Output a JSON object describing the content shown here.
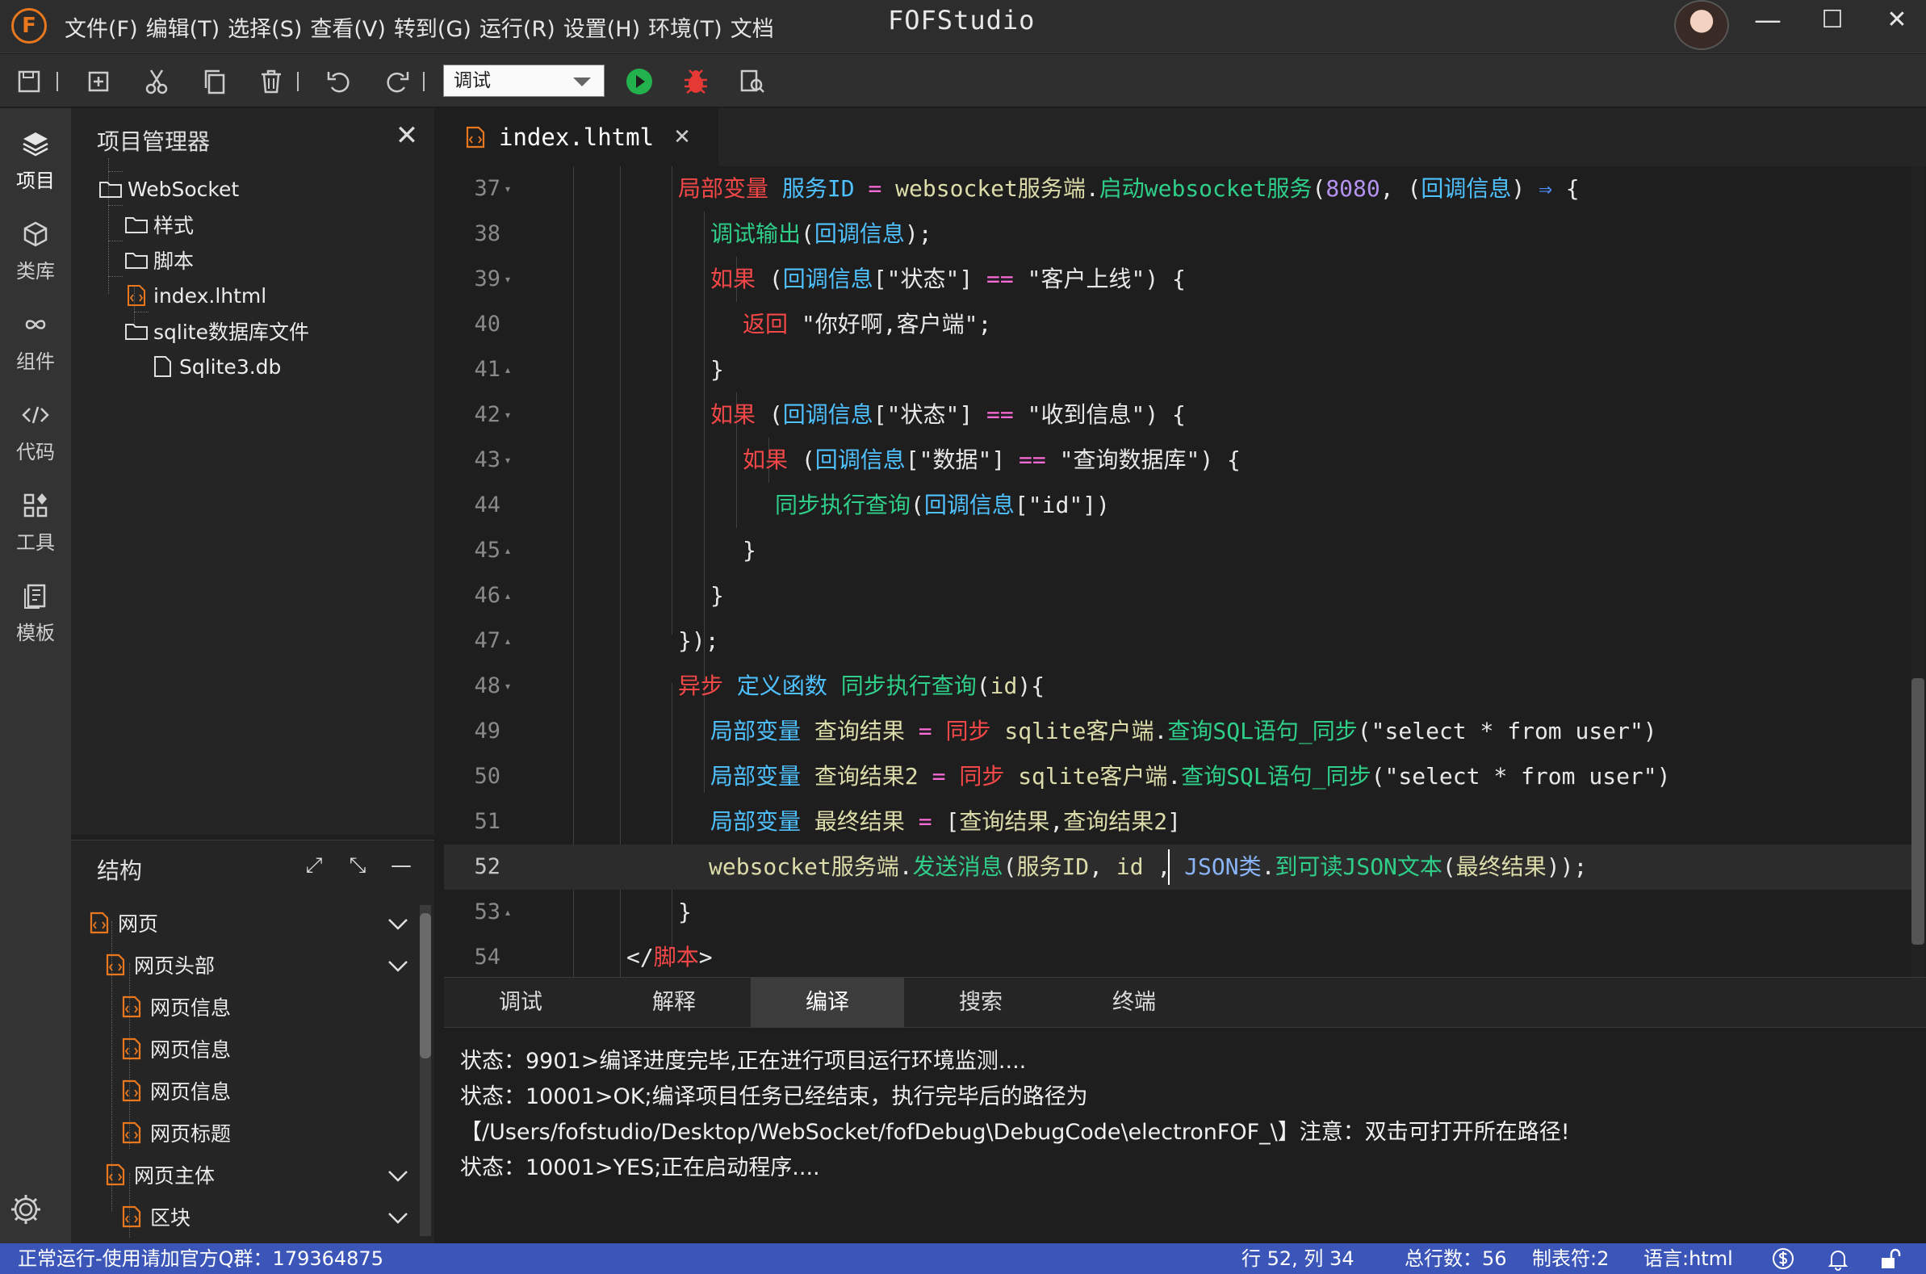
{
  "titlebar": {
    "logo": "F",
    "title": "FOFStudio",
    "menu": [
      "文件(F)",
      "编辑(T)",
      "选择(S)",
      "查看(V)",
      "转到(G)",
      "运行(R)",
      "设置(H)",
      "环境(T)",
      "文档"
    ],
    "window_buttons": {
      "minimize": "—",
      "maximize": "☐",
      "close": "✕"
    }
  },
  "toolbar": {
    "mode_value": "调试",
    "icons": [
      "save-icon",
      "new-file-icon",
      "cut-icon",
      "copy-icon",
      "delete-icon",
      "undo-icon",
      "redo-icon",
      "run-icon",
      "debug-icon",
      "find-icon"
    ]
  },
  "activitybar": {
    "items": [
      {
        "label": "项目",
        "icon": "layers-icon"
      },
      {
        "label": "类库",
        "icon": "cube-icon"
      },
      {
        "label": "组件",
        "icon": "infinity-icon"
      },
      {
        "label": "代码",
        "icon": "code-icon"
      },
      {
        "label": "工具",
        "icon": "tools-icon"
      },
      {
        "label": "模板",
        "icon": "template-icon"
      }
    ]
  },
  "project": {
    "title": "项目管理器",
    "close": "✕",
    "tree": [
      {
        "label": "WebSocket",
        "type": "folder"
      },
      {
        "label": "样式",
        "type": "folder"
      },
      {
        "label": "脚本",
        "type": "folder"
      },
      {
        "label": "index.lhtml",
        "type": "html"
      },
      {
        "label": "sqlite数据库文件",
        "type": "folder"
      },
      {
        "label": "Sqlite3.db",
        "type": "file"
      }
    ]
  },
  "structure": {
    "title": "结构",
    "expand": "⤢",
    "collapse": "⤡",
    "minimize": "—",
    "items": [
      {
        "label": "网页"
      },
      {
        "label": "网页头部"
      },
      {
        "label": "网页信息"
      },
      {
        "label": "网页信息"
      },
      {
        "label": "网页信息"
      },
      {
        "label": "网页标题"
      },
      {
        "label": "网页主体"
      },
      {
        "label": "区块"
      }
    ]
  },
  "editor": {
    "tab_label": "index.lhtml",
    "tab_close": "✕",
    "line_numbers": [
      "37",
      "38",
      "39",
      "40",
      "41",
      "42",
      "43",
      "44",
      "45",
      "46",
      "47",
      "48",
      "49",
      "50",
      "51",
      "52",
      "53",
      "54"
    ]
  },
  "output": {
    "tabs": [
      "调试",
      "解释",
      "编译",
      "搜索",
      "终端"
    ],
    "active_tab": "编译",
    "lines": [
      "状态：9901>编译进度完毕,正在进行项目运行环境监测....",
      "状态：10001>OK;编译项目任务已经结束，执行完毕后的路径为",
      "【/Users/fofstudio/Desktop/WebSocket/fofDebug\\DebugCode\\electronFOF_\\】注意：双击可打开所在路径!",
      "状态：10001>YES;正在启动程序...."
    ]
  },
  "statusbar": {
    "left": "正常运行-使用请加官方Q群：179364875",
    "position": "行 52, 列 34",
    "total_lines": "总行数：56",
    "tab_size": "制表符:2",
    "language": "语言:html"
  }
}
